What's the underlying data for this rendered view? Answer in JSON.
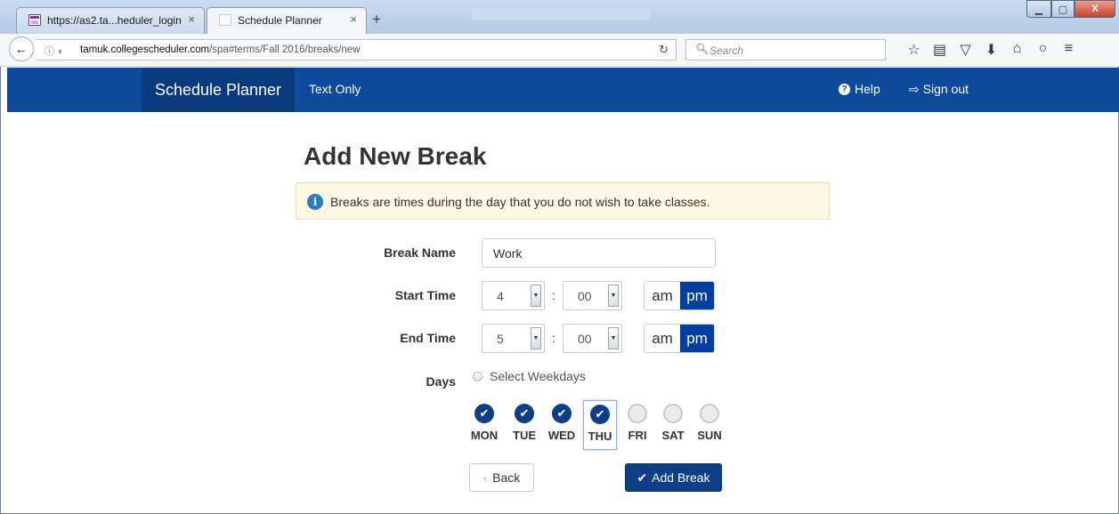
{
  "browser": {
    "tabs": [
      {
        "title": "https://as2.ta...heduler_login",
        "close": "×"
      },
      {
        "title": "Schedule Planner",
        "close": "×"
      }
    ],
    "new_tab": "+",
    "url_host": "tamuk.collegescheduler.com",
    "url_path": "/spa#terms/Fall 2016/breaks/new",
    "url_prefix": "",
    "search_placeholder": "Search",
    "window_buttons": {
      "minimize": "▁",
      "maximize": "▢",
      "close": "X"
    }
  },
  "app": {
    "brand": "Schedule Planner",
    "text_only": "Text Only",
    "help": "Help",
    "sign_out": "Sign out",
    "accent_color": "#0d4a9c"
  },
  "form": {
    "title": "Add New Break",
    "info": "Breaks are times during the day that you do not wish to take classes.",
    "break_name_label": "Break Name",
    "break_name_value": "Work",
    "start_time_label": "Start Time",
    "start_hour": "4",
    "start_minute": "00",
    "end_time_label": "End Time",
    "end_hour": "5",
    "end_minute": "00",
    "colon": ":",
    "am": "am",
    "pm": "pm",
    "days_label": "Days",
    "select_weekdays": "Select Weekdays",
    "days": [
      {
        "label": "MON",
        "checked": true
      },
      {
        "label": "TUE",
        "checked": true
      },
      {
        "label": "WED",
        "checked": true
      },
      {
        "label": "THU",
        "checked": true
      },
      {
        "label": "FRI",
        "checked": false
      },
      {
        "label": "SAT",
        "checked": false
      },
      {
        "label": "SUN",
        "checked": false
      }
    ],
    "back_label": "Back",
    "add_label": "Add Break"
  }
}
